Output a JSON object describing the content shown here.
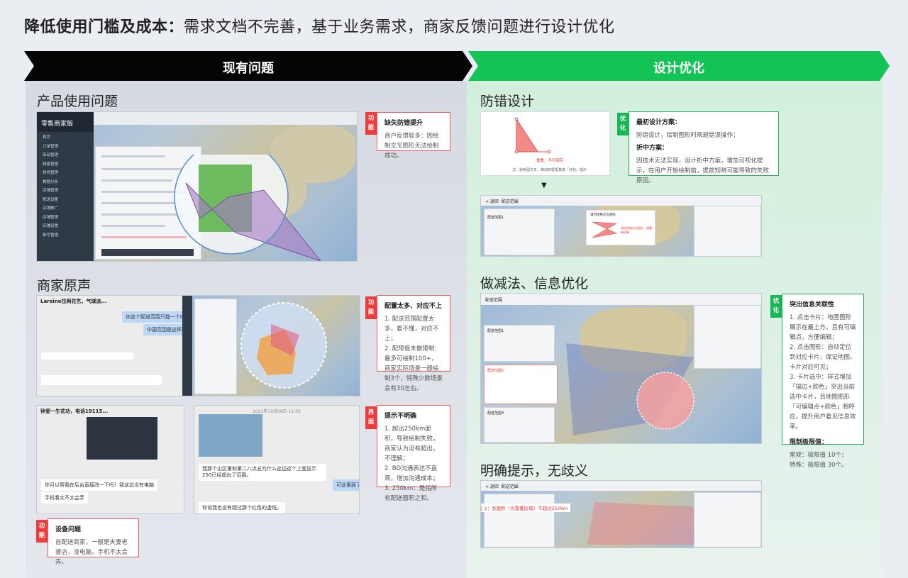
{
  "headline": {
    "bold": "降低使用门槛及成本：",
    "rest": "需求文档不完善，基于业务需求，商家反馈问题进行设计优化"
  },
  "banners": {
    "left": "现有问题",
    "right": "设计优化"
  },
  "left": {
    "section1_title": "产品使用问题",
    "section2_title": "商家原声",
    "app_name": "零售商家版",
    "sidebar_items": [
      "首页",
      "订单管理",
      "商品管理",
      "顾客管理",
      "财务管理",
      "数据分析",
      "店铺管理",
      "配送设置",
      "店铺推广",
      "店铺管理",
      "店铺设置",
      "账号管理"
    ],
    "chat1_title": "Laraine拉两花艺，气球派...",
    "chat2_title": "钟爱一生花功，电话19115...",
    "chat2_date": "2021年10月09日 11:03",
    "chat_bubbles": {
      "b1": "你这个配送范围只能一个吗",
      "b2": "中国范围是这样规",
      "b3": "我那个山区第和第二八点五为什么这边这个上面显示250已经超出了范围。",
      "b4": "你说我也设有超过那个红色的虚线。",
      "b5": "你可以帮我在后台直接改一下吗？我这边没有电脑",
      "b6": "手机看太不太会弄",
      "b7": "可这里面了啊"
    },
    "callouts": [
      {
        "tag": "功能",
        "title": "缺失防错提升",
        "body": "商户反馈较多：因绘制交叉图形无法绘制成功。"
      },
      {
        "tag": "功能",
        "title": "配置太多、对应不上",
        "body": "1. 配送范围配置太多，看不懂，对应不上；\n2. 配限值未做限制：最多可绘制100+，商家实际场景一般绘制3个，特殊少数场景会有30左右。"
      },
      {
        "tag": "界面",
        "title": "提示不明确",
        "body": "1. 超出250km面积，导致绘制失败，商家认为没有超出，不理解；\n2. BD沟通表达不直观，增加沟通成本；\n3. 250km：是指所有配送面积之和。"
      },
      {
        "tag": "功能",
        "title": "设备问题",
        "body": "自配送商家，一般是夫妻老婆店，没电脑，手机不太会弄。"
      }
    ]
  },
  "right": {
    "section1_title": "防错设计",
    "section2_title": "做减法、信息优化",
    "section3_title": "明确提示，无歧义",
    "err_label": "重叠，不可保存",
    "err_note": "注：避免图交叉，推动到框框角度「红色」提示",
    "arrow": "▼",
    "shot_header": "配送范围",
    "back_label": "< 返回",
    "popup_title": "请勿绘制交叉图形",
    "popup_body": "请勿绘制交叉图形，请重新绘制",
    "tip_text": "注 2：总面积（含重叠区域）不超过250km",
    "range_items": [
      "配送范围1",
      "配送范围2",
      "配送范围3"
    ],
    "callouts": [
      {
        "tag": "优化",
        "h1": "最初设计方案：",
        "b1": "防错设计，绘制图形时规避错误操作；",
        "h2": "折中方案：",
        "b2": "因技术无法实现，设计折中方案，增加可视化提示，在用户开始绘制前，提前知晓可能导致的失败原因。"
      },
      {
        "tag": "优化",
        "h1": "突出信息关联性",
        "b1": "1. 点击卡片：地图图形展示在最上方，且有可编辑点，方便编辑；\n2. 点击图形：自动定位到对应卡片，保证地图、卡片对应可见；\n3. 卡片选中：样式增加「描边+颜色」突出当前选中卡片，且地图图形「可编辑点+颜色」相呼应，提升用户看见信息效率。",
        "h2": "限制极限值：",
        "b2": "常规：极限值 10个；\n特殊：极限值 30个。"
      }
    ]
  },
  "colors": {
    "accent_red": "#ee3b3b",
    "accent_green": "#13c356",
    "banner_dark": "#050505"
  }
}
